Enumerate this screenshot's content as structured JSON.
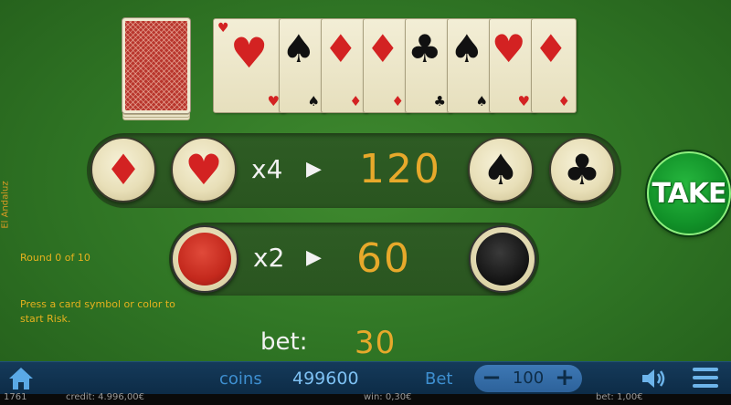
{
  "game": {
    "brand": "El Andaluz",
    "round_text": "Round 0 of 10",
    "hint_text": "Press a card symbol or color to start Risk."
  },
  "history": {
    "cards": [
      {
        "suit": "hearts",
        "symbol": "♥",
        "color": "red"
      },
      {
        "suit": "spades",
        "symbol": "♠",
        "color": "black"
      },
      {
        "suit": "diamonds",
        "symbol": "♦",
        "color": "red"
      },
      {
        "suit": "diamonds",
        "symbol": "♦",
        "color": "red"
      },
      {
        "suit": "clubs",
        "symbol": "♣",
        "color": "black"
      },
      {
        "suit": "spades",
        "symbol": "♠",
        "color": "black"
      },
      {
        "suit": "hearts",
        "symbol": "♥",
        "color": "red"
      },
      {
        "suit": "diamonds",
        "symbol": "♦",
        "color": "red"
      }
    ]
  },
  "suit_row": {
    "multiplier": "x4",
    "arrow": "▶",
    "payout": "120",
    "buttons": {
      "diamond": "♦",
      "heart": "♥",
      "spade": "♠",
      "club": "♣"
    }
  },
  "color_row": {
    "multiplier": "x2",
    "arrow": "▶",
    "payout": "60"
  },
  "take_label": "TAKE",
  "bet": {
    "label": "bet:",
    "value": "30"
  },
  "bottom_bar": {
    "coins_label": "coins",
    "coins_value": "499600",
    "bet_label": "Bet",
    "bet_value": "100",
    "minus": "−",
    "plus": "+"
  },
  "status_bar": {
    "id": "1761",
    "credit": "credit: 4.996,00€",
    "win": "win: 0,30€",
    "bet": "bet: 1,00€"
  },
  "colors": {
    "felt": "#2f7424",
    "accent": "#e7a92b",
    "take": "#119128",
    "bottom_bar": "#0d2c47"
  }
}
